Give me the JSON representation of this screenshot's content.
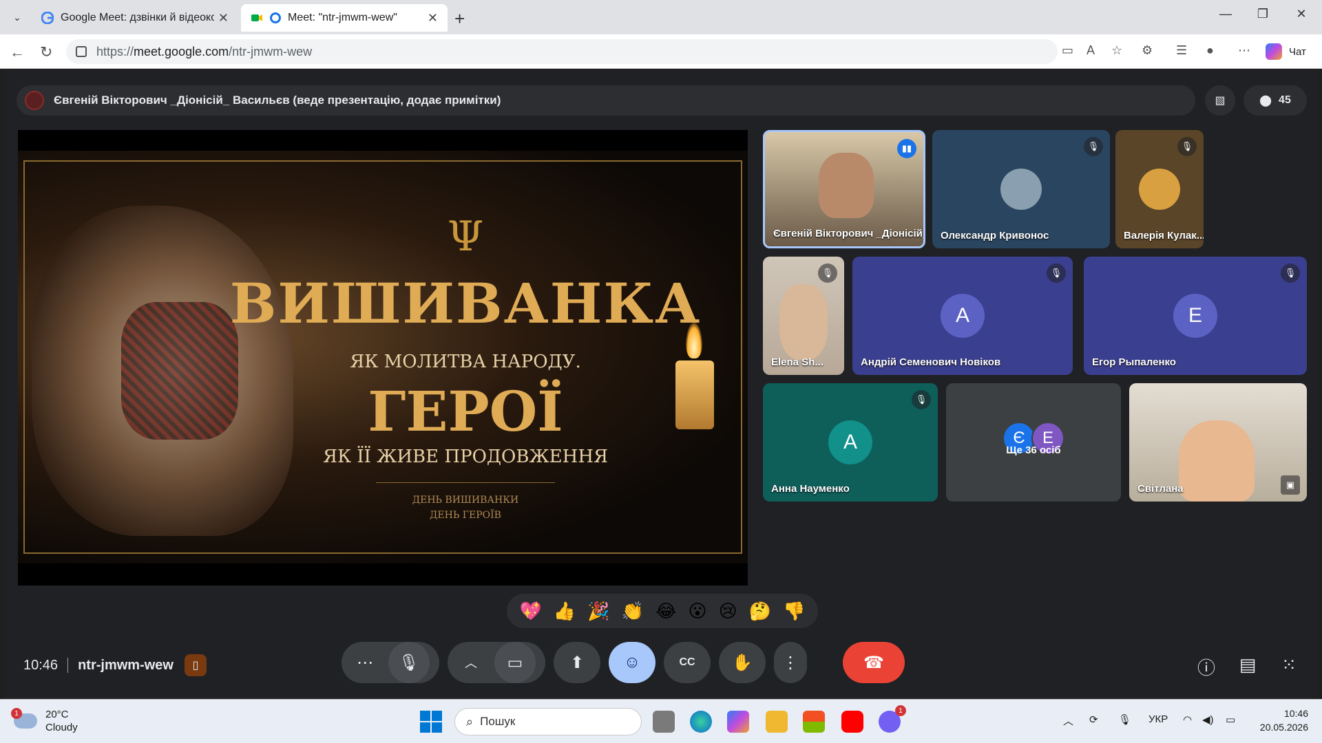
{
  "browser": {
    "tabs": [
      {
        "title": "Google Meet: дзвінки й відеоконф",
        "active": false
      },
      {
        "title": "Meet: \"ntr-jmwm-wew\"",
        "active": true
      }
    ],
    "url_protocol": "https://",
    "url_host": "meet.google.com",
    "url_path": "/ntr-jmwm-wew",
    "chat_label": "Чат"
  },
  "meet": {
    "presenter_banner": "Євгеній Вікторович _Діонісій_ Васильєв (веде презентацію, додає примітки)",
    "participant_count": "45",
    "slide": {
      "title1": "ВИШИВАНКА",
      "subtitle1": "ЯК МОЛИТВА НАРОДУ.",
      "title2": "ГЕРОЇ",
      "subtitle2": "ЯК ЇЇ ЖИВЕ ПРОДОВЖЕННЯ",
      "footer1": "ДЕНЬ ВИШИВАНКИ",
      "footer2": "ДЕНЬ ГЕРОЇВ",
      "trident": "Ψ"
    },
    "participants": [
      {
        "name": "Євгеній Вікторович _Діонісій_ Ва...",
        "type": "video",
        "speaking": true
      },
      {
        "name": "Олександр Кривонос",
        "type": "avatar",
        "muted": true
      },
      {
        "name": "Валерія Кулак...",
        "type": "avatar",
        "muted": true
      },
      {
        "name": "Elena Sh...",
        "type": "video",
        "muted": true
      },
      {
        "name": "Андрій Семенович Новіков",
        "type": "letter",
        "letter": "А",
        "muted": true
      },
      {
        "name": "Егор Рыпаленко",
        "type": "letter",
        "letter": "Е",
        "muted": true
      },
      {
        "name": "Анна Науменко",
        "type": "letter",
        "letter": "А",
        "muted": true
      },
      {
        "name": "Ще 36 осіб",
        "type": "more",
        "letters": [
          "Є",
          "Е"
        ]
      },
      {
        "name": "Світлана",
        "type": "video"
      }
    ],
    "reactions": [
      "💖",
      "👍",
      "🎉",
      "👏",
      "😂",
      "😮",
      "😢",
      "🤔",
      "👎"
    ],
    "time": "10:46",
    "meeting_code": "ntr-jmwm-wew"
  },
  "taskbar": {
    "temperature": "20°C",
    "weather": "Cloudy",
    "weather_badge": "1",
    "search_placeholder": "Пошук",
    "language": "УКР",
    "time": "10:46",
    "date": "20.05.2026",
    "viber_badge": "1"
  },
  "colors": {
    "meet_bg": "#202124",
    "accent_blue": "#a8c7fa",
    "end_call_red": "#ea4335"
  }
}
